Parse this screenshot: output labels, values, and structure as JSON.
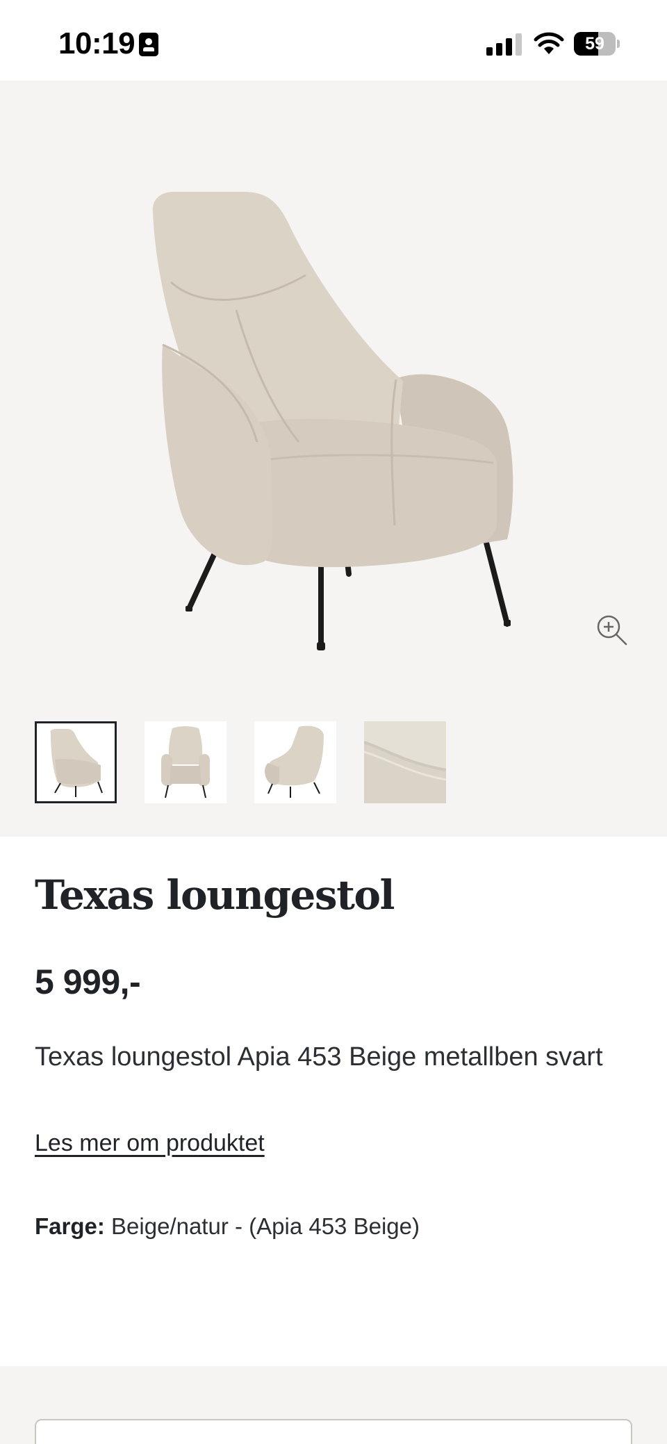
{
  "status_bar": {
    "time": "10:19",
    "battery_level": "59",
    "battery_fraction": 0.59,
    "signal_bars_active": 3,
    "signal_bars_total": 4,
    "icons": [
      "id-card-icon",
      "signal-icon",
      "wifi-icon",
      "battery-icon"
    ]
  },
  "gallery": {
    "main_image_alt": "chair-image",
    "zoom_icon": "zoom-in-icon",
    "selected_thumbnail": 0,
    "thumbnails": [
      {
        "view": "chair-front-angle"
      },
      {
        "view": "chair-front"
      },
      {
        "view": "chair-back-angle"
      },
      {
        "view": "fabric-closeup"
      }
    ]
  },
  "product": {
    "title": "Texas loungestol",
    "price": "5 999,-",
    "description": "Texas loungestol Apia 453 Beige metallben svart",
    "read_more_link": "Les mer om produktet",
    "color_label": "Farge:",
    "color_value": "Beige/natur - (Apia 453 Beige)"
  },
  "colors": {
    "text_primary": "#1f2328",
    "gallery_background": "#f5f4f2",
    "fabric": "#d9d0c3",
    "legs": "#1b1b1b"
  }
}
